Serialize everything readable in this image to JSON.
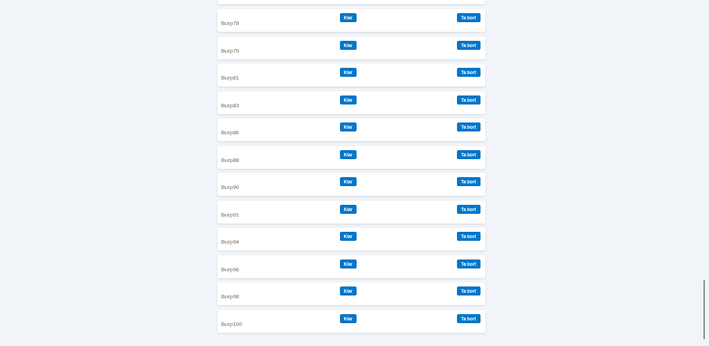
{
  "items": [
    {
      "name": "Burp78",
      "done_button": "Klar",
      "remove_button": "Ta bort"
    },
    {
      "name": "Burp79",
      "done_button": "Klar",
      "remove_button": "Ta bort"
    },
    {
      "name": "Burp81",
      "done_button": "Klar",
      "remove_button": "Ta bort"
    },
    {
      "name": "Burp83",
      "done_button": "Klar",
      "remove_button": "Ta bort"
    },
    {
      "name": "Burp86",
      "done_button": "Klar",
      "remove_button": "Ta bort"
    },
    {
      "name": "Burp88",
      "done_button": "Klar",
      "remove_button": "Ta bort"
    },
    {
      "name": "Burp90",
      "done_button": "Klar",
      "remove_button": "Ta bort"
    },
    {
      "name": "Burp91",
      "done_button": "Klar",
      "remove_button": "Ta bort"
    },
    {
      "name": "Burp94",
      "done_button": "Klar",
      "remove_button": "Ta bort"
    },
    {
      "name": "Burp96",
      "done_button": "Klar",
      "remove_button": "Ta bort"
    },
    {
      "name": "Burp98",
      "done_button": "Klar",
      "remove_button": "Ta bort"
    },
    {
      "name": "Burp100",
      "done_button": "Klar",
      "remove_button": "Ta bort"
    }
  ]
}
